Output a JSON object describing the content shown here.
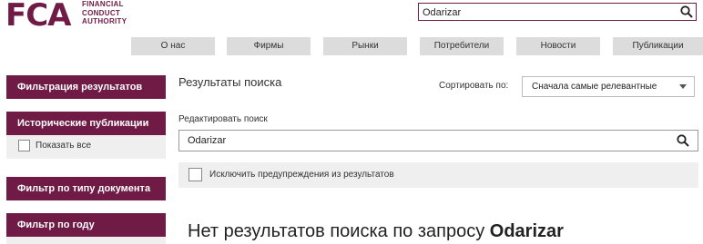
{
  "logo": {
    "mark": "FCA",
    "lines": [
      "FINANCIAL",
      "CONDUCT",
      "AUTHORITY"
    ]
  },
  "header_search": {
    "value": "Odarizar"
  },
  "nav": {
    "items": [
      {
        "label": "О нас"
      },
      {
        "label": "Фирмы"
      },
      {
        "label": "Рынки"
      },
      {
        "label": "Потребители"
      },
      {
        "label": "Новости"
      },
      {
        "label": "Публикации"
      }
    ]
  },
  "sidebar": {
    "filter_results": "Фильтрация результатов",
    "historical": "Исторические публикации",
    "show_all": "Показать все",
    "filter_doc_type": "Фильтр по типу документа",
    "filter_year": "Фильтр по году"
  },
  "main": {
    "results_title": "Результаты поиска",
    "sort_label": "Сортировать по:",
    "sort_value": "Сначала самые релевантные",
    "edit_label": "Редактировать поиск",
    "search_value": "Odarizar",
    "exclude_label": "Исключить предупреждения из результатов",
    "no_results_prefix": "Нет результатов поиска по запросу",
    "no_results_query": "Odarizar"
  },
  "colors": {
    "brand": "#701b45",
    "panel": "#efefef",
    "nav_bg": "#dcdcdc"
  }
}
